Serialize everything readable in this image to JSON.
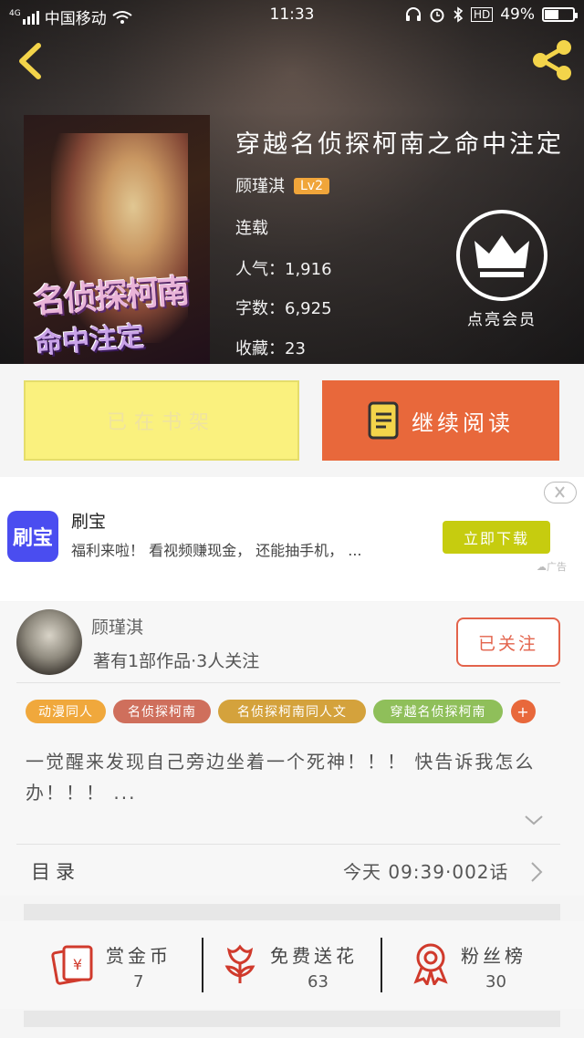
{
  "status_bar": {
    "carrier": "中国移动",
    "network": "4G",
    "time": "11:33",
    "battery": "49%",
    "battery_level": 0.49,
    "hd": "HD"
  },
  "book": {
    "title": "穿越名侦探柯南之命中注定",
    "author": "顾瑾淇",
    "level": "Lv2",
    "status": "连载",
    "popularity_label": "人气：",
    "popularity": "1,916",
    "words_label": "字数：",
    "words": "6,925",
    "favorites_label": "收藏：",
    "favorites": "23",
    "cover_title_1": "名侦探柯南",
    "cover_title_2": "命中注定"
  },
  "vip": {
    "label": "点亮会员"
  },
  "actions": {
    "shelf": "已在书架",
    "read": "继续阅读"
  },
  "ad": {
    "logo_text": "刷宝",
    "name": "刷宝",
    "text": "福利来啦！ 看视频赚现金， 还能抽手机， ...",
    "button": "立即下载",
    "tag": "广告"
  },
  "author_card": {
    "name": "顾瑾淇",
    "info": "著有1部作品·3人关注",
    "follow": "已关注"
  },
  "tags": [
    {
      "label": "动漫同人",
      "color": "#f0a83c"
    },
    {
      "label": "名侦探柯南",
      "color": "#cf6f5c"
    },
    {
      "label": "名侦探柯南同人文",
      "color": "#d4a23c"
    },
    {
      "label": "穿越名侦探柯南",
      "color": "#8fbf5a"
    },
    {
      "label": "+",
      "color": "#e8683b"
    }
  ],
  "description": "一觉醒来发现自己旁边坐着一个死神！！！ 快告诉我怎么办！！！ ...",
  "toc": {
    "title": "目录",
    "info": "今天 09:39·002话"
  },
  "stats": [
    {
      "label": "赏金币",
      "value": "7",
      "icon": "red-envelope-icon"
    },
    {
      "label": "免费送花",
      "value": "63",
      "icon": "flower-icon"
    },
    {
      "label": "粉丝榜",
      "value": "30",
      "icon": "medal-icon"
    }
  ],
  "colors": {
    "accent": "#e8683b",
    "shelf": "#faf17e",
    "ad_button": "#c6cc0f",
    "follow": "#e3634b"
  }
}
